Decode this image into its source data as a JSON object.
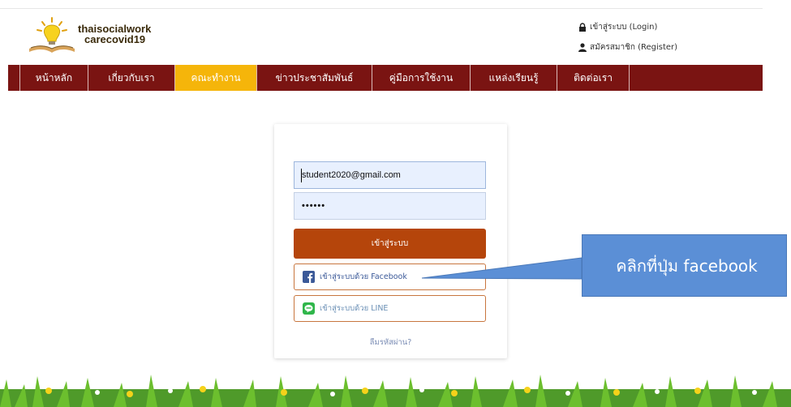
{
  "brand": {
    "line1": "thaisocialwork",
    "line2": "carecovid19"
  },
  "auth": {
    "login": "เข้าสู่ระบบ (Login)",
    "register": "สมัครสมาชิก (Register)"
  },
  "nav": [
    {
      "label": "หน้าหลัก",
      "active": false
    },
    {
      "label": "เกี่ยวกับเรา",
      "active": false
    },
    {
      "label": "คณะทำงาน",
      "active": true
    },
    {
      "label": "ข่าวประชาสัมพันธ์",
      "active": false
    },
    {
      "label": "คู่มือการใช้งาน",
      "active": false
    },
    {
      "label": "แหล่งเรียนรู้",
      "active": false
    },
    {
      "label": "ติดต่อเรา",
      "active": false
    }
  ],
  "form": {
    "email_value": "student2020@gmail.com",
    "password_value": "••••••",
    "login_button": "เข้าสู่ระบบ",
    "facebook_button": "เข้าสู่ระบบด้วย Facebook",
    "line_button": "เข้าสู่ระบบด้วย LINE",
    "forgot": "ลืมรหัสผ่าน?"
  },
  "callout": {
    "text": "คลิกที่ปุ่ม facebook"
  },
  "colors": {
    "nav_bg": "#7a1412",
    "nav_active": "#f5b50a",
    "login_button": "#b5450b",
    "callout": "#5b8fd6",
    "facebook": "#3b5998",
    "line": "#2fb64a"
  },
  "icons": {
    "lock": "lock-icon",
    "user": "user-icon",
    "facebook": "facebook-icon",
    "line": "line-icon",
    "logo": "lightbulb-book-logo"
  }
}
